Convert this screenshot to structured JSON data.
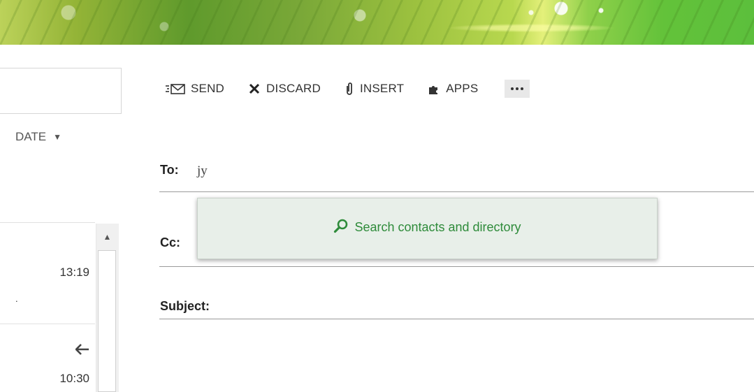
{
  "toolbar": {
    "send_label": "SEND",
    "discard_label": "DISCARD",
    "insert_label": "INSERT",
    "apps_label": "APPS",
    "more_icon": "ellipsis-icon"
  },
  "list": {
    "sort_label": "DATE",
    "items": [
      {
        "time": "13:19",
        "preview": "."
      },
      {
        "time": "10:30",
        "status_icon": "reply-arrow-icon"
      }
    ]
  },
  "compose": {
    "to_label": "To:",
    "to_value": "jy",
    "cc_label": "Cc:",
    "subject_label": "Subject:"
  },
  "autocomplete": {
    "search_label": "Search contacts and directory"
  },
  "colors": {
    "accent_green": "#2e8b3a",
    "popup_bg": "#e8efe9"
  }
}
